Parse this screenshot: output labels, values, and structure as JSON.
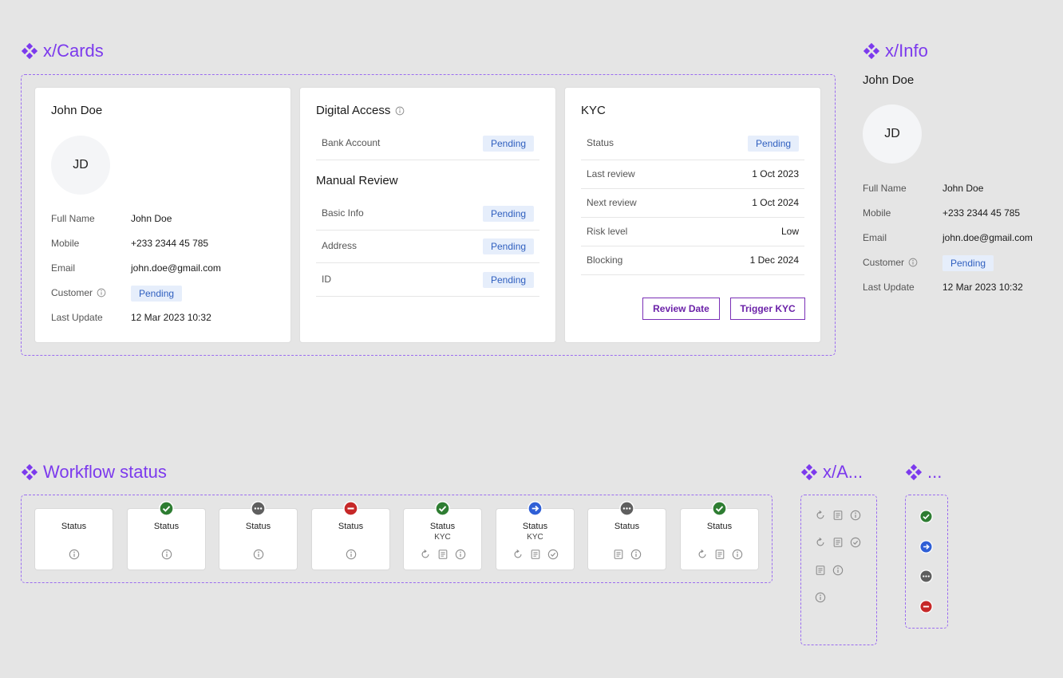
{
  "sections": {
    "cards_title": "x/Cards",
    "info_title": "x/Info",
    "workflow_title": "Workflow status",
    "actions_title": "x/A...",
    "dots_title": "..."
  },
  "profile_card": {
    "name": "John Doe",
    "initials": "JD",
    "fields": [
      {
        "label": "Full Name",
        "value": "John Doe"
      },
      {
        "label": "Mobile",
        "value": "+233 2344 45 785"
      },
      {
        "label": "Email",
        "value": "john.doe@gmail.com"
      },
      {
        "label": "Customer",
        "value": "Pending"
      },
      {
        "label": "Last Update",
        "value": "12 Mar 2023 10:32"
      }
    ]
  },
  "digital_access_card": {
    "title": "Digital Access",
    "bank_account_label": "Bank Account",
    "bank_account_status": "Pending",
    "manual_review_title": "Manual Review",
    "rows": [
      {
        "label": "Basic Info",
        "status": "Pending"
      },
      {
        "label": "Address",
        "status": "Pending"
      },
      {
        "label": "ID",
        "status": "Pending"
      }
    ]
  },
  "kyc_card": {
    "title": "KYC",
    "rows": [
      {
        "label": "Status",
        "value": "Pending"
      },
      {
        "label": "Last review",
        "value": "1 Oct 2023"
      },
      {
        "label": "Next review",
        "value": "1 Oct 2024"
      },
      {
        "label": "Risk level",
        "value": "Low"
      },
      {
        "label": "Blocking",
        "value": "1 Dec 2024"
      }
    ],
    "review_date_button": "Review Date",
    "trigger_kyc_button": "Trigger KYC"
  },
  "info_panel": {
    "name": "John Doe",
    "initials": "JD",
    "fields": [
      {
        "label": "Full Name",
        "value": "John Doe"
      },
      {
        "label": "Mobile",
        "value": "+233 2344 45 785"
      },
      {
        "label": "Email",
        "value": "john.doe@gmail.com"
      },
      {
        "label": "Customer",
        "value": "Pending"
      },
      {
        "label": "Last Update",
        "value": "12 Mar 2023 10:32"
      }
    ]
  },
  "workflow_tiles": [
    {
      "label": "Status",
      "sub": "",
      "status": "none",
      "icons": [
        "info-icon"
      ]
    },
    {
      "label": "Status",
      "sub": "",
      "status": "success",
      "icons": [
        "info-icon"
      ]
    },
    {
      "label": "Status",
      "sub": "",
      "status": "pending",
      "icons": [
        "info-icon"
      ]
    },
    {
      "label": "Status",
      "sub": "",
      "status": "blocked",
      "icons": [
        "info-icon"
      ]
    },
    {
      "label": "Status",
      "sub": "KYC",
      "status": "success",
      "icons": [
        "refresh-icon",
        "document-icon",
        "info-icon"
      ]
    },
    {
      "label": "Status",
      "sub": "KYC",
      "status": "in-progress",
      "icons": [
        "refresh-icon",
        "document-icon",
        "check-circle-icon"
      ]
    },
    {
      "label": "Status",
      "sub": "",
      "status": "pending",
      "icons": [
        "document-icon",
        "info-icon"
      ]
    },
    {
      "label": "Status",
      "sub": "",
      "status": "success",
      "icons": [
        "refresh-icon",
        "document-icon",
        "info-icon"
      ]
    }
  ],
  "colors": {
    "accent": "#7c3aed",
    "success": "#2e7d32",
    "in_progress": "#2f5fd6",
    "pending": "#5f5f5f",
    "blocked": "#c62828",
    "badge_bg": "#e6eefb",
    "badge_text": "#2f5fbf"
  }
}
